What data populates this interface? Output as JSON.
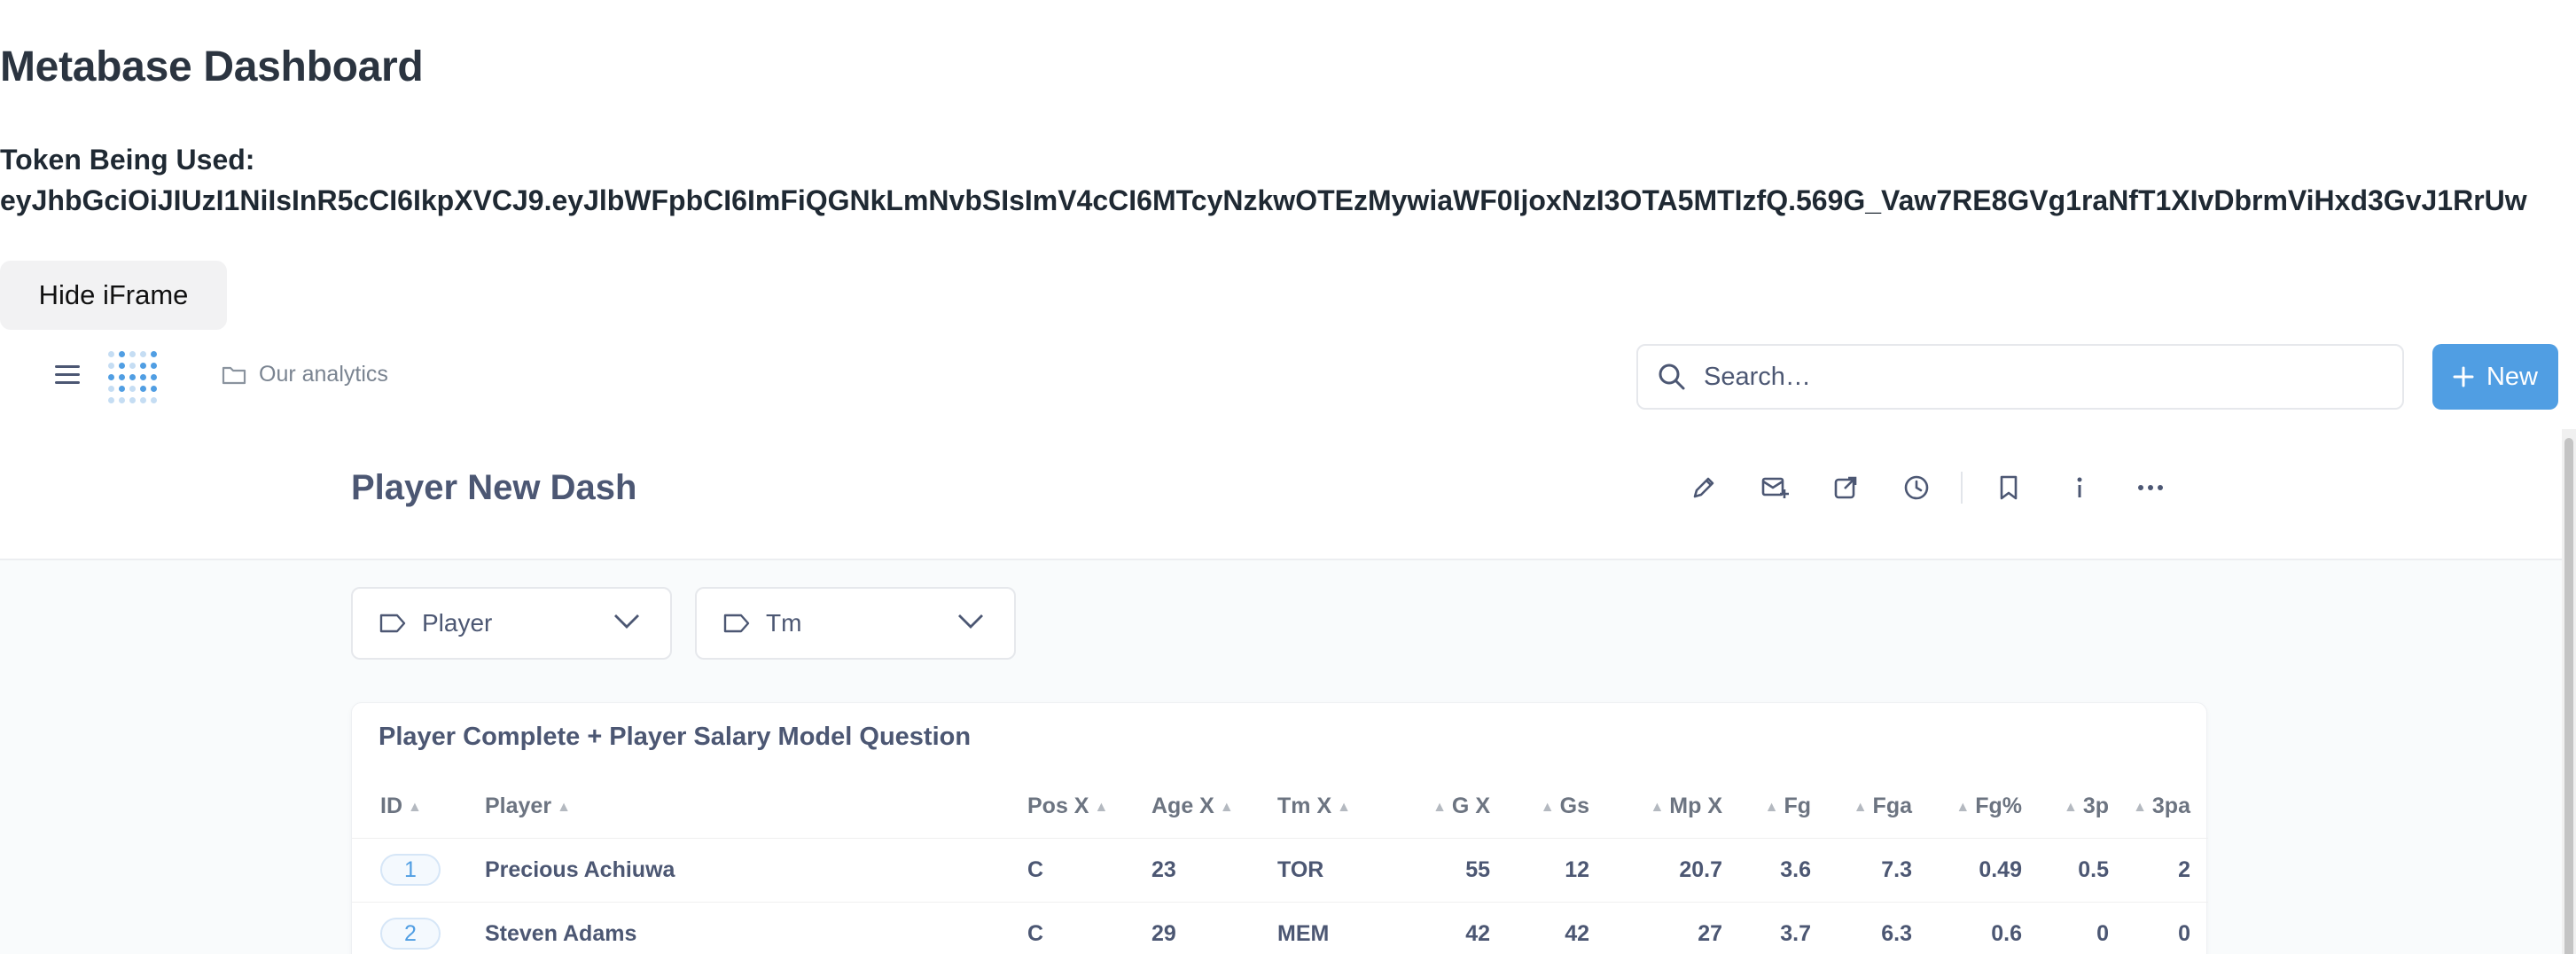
{
  "page": {
    "title": "Metabase Dashboard",
    "token_label": "Token Being Used:",
    "token_value": "eyJhbGciOiJIUzI1NiIsInR5cCI6IkpXVCJ9.eyJlbWFpbCI6ImFiQGNkLmNvbSIsImV4cCI6MTcyNzkwOTEzMywiaWF0IjoxNzI3OTA5MTIzfQ.569G_Vaw7RE8GVg1raNfT1XIvDbrmViHxd3GvJ1RrUw",
    "hide_button": "Hide iFrame"
  },
  "nav": {
    "breadcrumb": "Our analytics",
    "search_placeholder": "Search…",
    "new_button": "New"
  },
  "dashboard": {
    "title": "Player New Dash",
    "filters": [
      "Player",
      "Tm"
    ]
  },
  "card": {
    "title": "Player Complete + Player Salary Model Question",
    "columns": [
      "ID",
      "Player",
      "Pos X",
      "Age X",
      "Tm X",
      "G X",
      "Gs",
      "Mp X",
      "Fg",
      "Fga",
      "Fg%",
      "3p",
      "3pa"
    ],
    "rows": [
      [
        "1",
        "Precious Achiuwa",
        "C",
        "23",
        "TOR",
        "55",
        "12",
        "20.7",
        "3.6",
        "7.3",
        "0.49",
        "0.5",
        "2"
      ],
      [
        "2",
        "Steven Adams",
        "C",
        "29",
        "MEM",
        "42",
        "42",
        "27",
        "3.7",
        "6.3",
        "0.6",
        "0",
        "0"
      ]
    ]
  },
  "colors": {
    "accent": "#509ee3",
    "text": "#4c5773",
    "background": "#f9fbfc"
  }
}
